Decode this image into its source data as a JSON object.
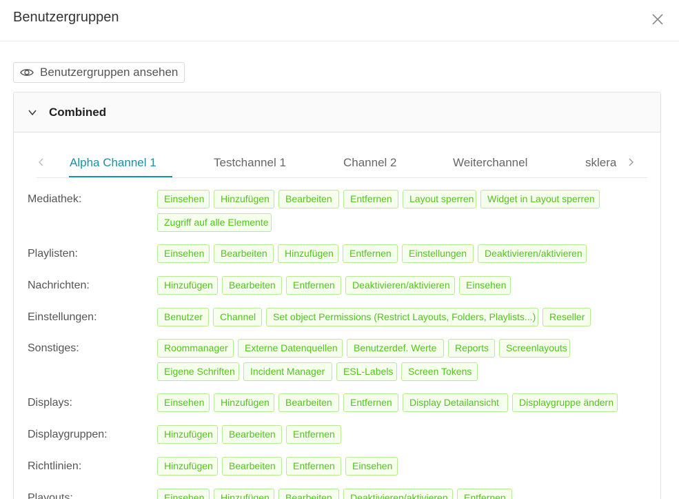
{
  "header": {
    "title": "Benutzergruppen"
  },
  "view_button": {
    "label": "Benutzergruppen ansehen"
  },
  "panel": {
    "title": "Combined"
  },
  "tabs": [
    "Alpha Channel 1",
    "Testchannel 1",
    "Channel 2",
    "Weiterchannel",
    "sklera"
  ],
  "active_tab": 0,
  "colors": {
    "accent": "#1890a5",
    "tag_text": "#52c41a",
    "tag_border": "#b7eb8f",
    "tag_bg": "#f6ffed"
  },
  "permissions": [
    {
      "label": "Mediathek:",
      "tags": [
        "Einsehen",
        "Hinzufügen",
        "Bearbeiten",
        "Entfernen",
        "Layout sperren",
        "Widget in Layout sperren",
        "Zugriff auf alle Elemente"
      ]
    },
    {
      "label": "Playlisten:",
      "tags": [
        "Einsehen",
        "Bearbeiten",
        "Hinzufügen",
        "Entfernen",
        "Einstellungen",
        "Deaktivieren/aktivieren"
      ]
    },
    {
      "label": "Nachrichten:",
      "tags": [
        "Hinzufügen",
        "Bearbeiten",
        "Entfernen",
        "Deaktivieren/aktivieren",
        "Einsehen"
      ]
    },
    {
      "label": "Einstellungen:",
      "tags": [
        "Benutzer",
        "Channel",
        "Set object Permissions (Restrict Layouts, Folders, Playlists...)",
        "Reseller"
      ]
    },
    {
      "label": "Sonstiges:",
      "tags": [
        "Roommanager",
        "Externe Datenquellen",
        "Benutzerdef. Werte",
        "Reports",
        "Screenlayouts",
        "Eigene Schriften",
        "Incident Manager",
        "ESL-Labels",
        "Screen Tokens"
      ]
    },
    {
      "label": "Displays:",
      "tags": [
        "Einsehen",
        "Hinzufügen",
        "Bearbeiten",
        "Entfernen",
        "Display Detailansicht",
        "Displaygruppe ändern"
      ]
    },
    {
      "label": "Displaygruppen:",
      "tags": [
        "Hinzufügen",
        "Bearbeiten",
        "Entfernen"
      ]
    },
    {
      "label": "Richtlinien:",
      "tags": [
        "Hinzufügen",
        "Bearbeiten",
        "Entfernen",
        "Einsehen"
      ]
    },
    {
      "label": "Playouts:",
      "tags": [
        "Einsehen",
        "Hinzufügen",
        "Bearbeiten",
        "Deaktivieren/aktivieren",
        "Entfernen"
      ]
    }
  ]
}
